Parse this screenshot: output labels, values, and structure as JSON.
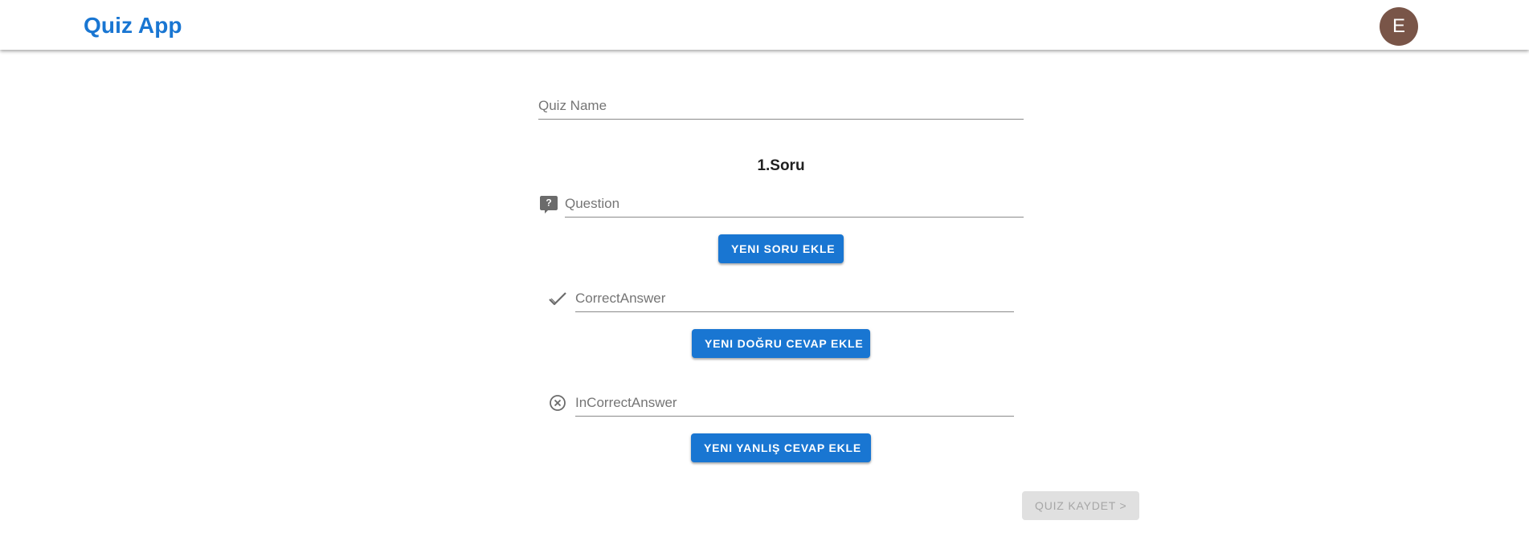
{
  "header": {
    "title": "Quiz App",
    "avatar_initial": "E",
    "avatar_color": "#795548",
    "title_color": "#1976d2"
  },
  "form": {
    "quiz_name_placeholder": "Quiz Name",
    "question_section_title": "1.Soru",
    "question_placeholder": "Question",
    "add_question_label": "YENI SORU EKLE",
    "correct_answer_placeholder": "CorrectAnswer",
    "add_correct_label": "YENI DOĞRU CEVAP EKLE",
    "incorrect_answer_placeholder": "InCorrectAnswer",
    "add_incorrect_label": "YENI YANLIŞ CEVAP EKLE",
    "save_label": "QUIZ KAYDET >"
  },
  "icons": {
    "question": "question-comment-icon",
    "correct": "check-icon",
    "incorrect": "cancel-circle-icon"
  },
  "colors": {
    "primary": "#1976d2",
    "disabled_bg": "#e0e0e0",
    "disabled_text": "#a6a6a6"
  }
}
